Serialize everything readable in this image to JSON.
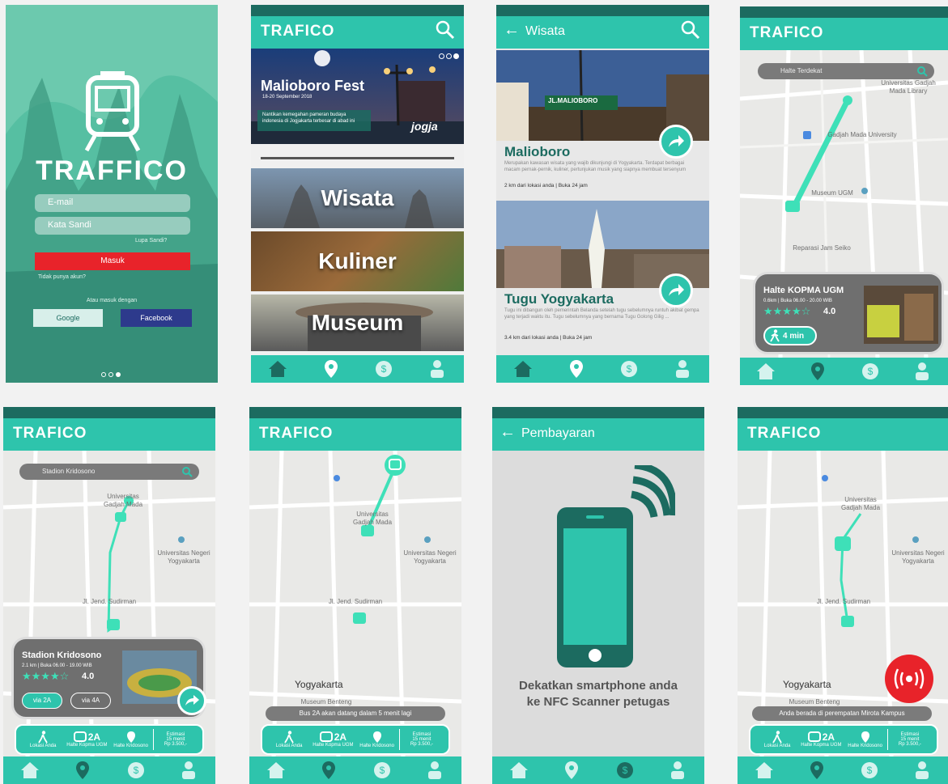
{
  "colors": {
    "teal": "#2ec4ac",
    "dark_teal": "#1c6b60",
    "red": "#e8232a",
    "facebook": "#2d3a8c"
  },
  "login": {
    "brand": "TRAFFICO",
    "email_placeholder": "E-mail",
    "password_placeholder": "Kata Sandi",
    "forgot": "Lupa Sandi?",
    "masuk": "Masuk",
    "register": "Tidak punya akun?",
    "or_login_with": "Atau masuk dengan",
    "google": "Google",
    "facebook": "Facebook"
  },
  "home": {
    "brand": "TRAFICO",
    "banner_title": "Malioboro Fest",
    "banner_date": "18-20 September 2018",
    "banner_desc": "Nantikan kemegahan pameran budaya indonesia di Jogjakarta terbesar di abad ini",
    "banner_logo": "jogja",
    "categories": [
      "Wisata",
      "Kuliner",
      "Museum"
    ]
  },
  "wisata": {
    "title": "Wisata",
    "sign": "JL.MALIOBORO",
    "places": [
      {
        "name": "Malioboro",
        "desc": "Merupakan kawasan wisata yang wajib dikunjungi di Yogyakarta. Terdapat berbagai macam pernak-pernik, kuliner, pertunjukan musik yang siapnya membuat tersenyum",
        "meta": "2 km dari lokasi anda | Buka 24 jam"
      },
      {
        "name": "Tugu Yogyakarta",
        "desc": "Tugu ini dibangun oleh pemerintah Belanda setelah tugu sebelumnya runtuh akibat gempa yang terjadi waktu itu. Tugu sebelumnya yang bernama Tugu Golong Gilig ...",
        "meta": "3.4 km dari lokasi anda | Buka 24 jam"
      }
    ]
  },
  "halte": {
    "brand": "TRAFICO",
    "search_value": "Halte Terdekat",
    "map_labels": [
      "Universitas Gadjah Mada Library",
      "Gadjah Mada University",
      "Museum UGM",
      "Reparasi Jam Seiko"
    ],
    "card_name": "Halte KOPMA UGM",
    "card_info": "0.6km | Buka 06.00 - 20.00 WIB",
    "rating": "4.0",
    "walk": "4 min"
  },
  "stadion": {
    "brand": "TRAFICO",
    "search_value": "Stadion Kridosono",
    "map_labels": [
      "Universitas Gadjah Mada",
      "Universitas Negeri Yogyakarta",
      "Jl. Jend. Sudirman"
    ],
    "card_name": "Stadion Kridosono",
    "card_info": "2.1 km | Buka 06.00 - 19.00 WIB",
    "rating": "4.0",
    "via1": "via 2A",
    "via2": "via 4A",
    "route": {
      "walk_caption": "Lokasi Anda",
      "bus": "2A",
      "bus_caption": "Halte Kopma UGM",
      "dest_caption": "Halte Kridosono",
      "eta": "15 menit",
      "price": "Rp 3.500,-",
      "eta_label": "Estimasi"
    }
  },
  "tracking": {
    "brand": "TRAFICO",
    "map_labels": [
      "Universitas Gadjah Mada",
      "Universitas Negeri Yogyakarta",
      "Jl. Jend. Sudirman",
      "Yogyakarta",
      "Museum Benteng"
    ],
    "toast": "Bus 2A akan datang dalam 5 menit lagi",
    "route": {
      "walk_caption": "Lokasi Anda",
      "bus": "2A",
      "bus_caption": "Halte Kopma UGM",
      "dest_caption": "Halte Kridosono",
      "eta": "15 menit",
      "price": "Rp 3.500,-",
      "eta_label": "Estimasi"
    }
  },
  "payment": {
    "title": "Pembayaran",
    "instruction_line1": "Dekatkan smartphone anda",
    "instruction_line2": "ke NFC Scanner petugas"
  },
  "alert": {
    "brand": "TRAFICO",
    "map_labels": [
      "Universitas Gadjah Mada",
      "Universitas Negeri Yogyakarta",
      "Jl. Jend. Sudirman",
      "Yogyakarta",
      "Museum Benteng"
    ],
    "toast": "Anda berada di perempatan Mirota Kampus",
    "route": {
      "walk_caption": "Lokasi Anda",
      "bus": "2A",
      "bus_caption": "Halte Kopma UGM",
      "dest_caption": "Halte Kridosono",
      "eta": "15 menit",
      "price": "Rp 3.500,-",
      "eta_label": "Estimasi"
    }
  }
}
